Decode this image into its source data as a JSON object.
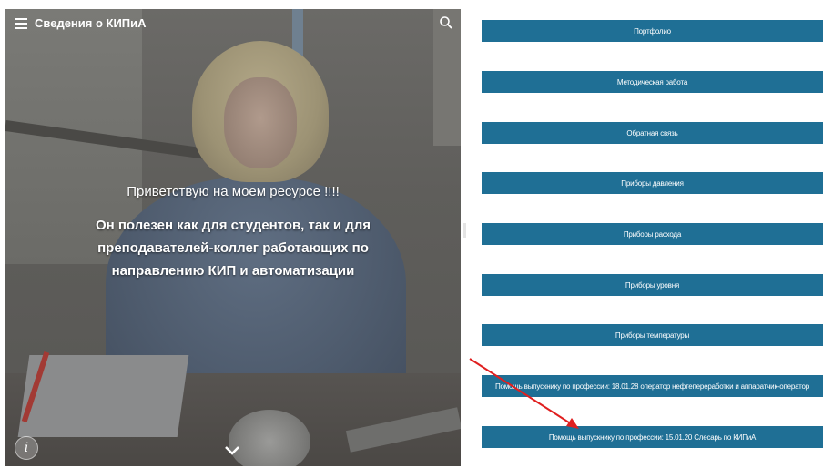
{
  "header": {
    "title": "Сведения о КИПиА"
  },
  "hero": {
    "greeting": "Приветствую на моем ресурсе !!!!",
    "description": "Он полезен как для студентов, так и для преподавателей-коллег работающих по направлению КИП и автоматизации"
  },
  "nav": {
    "buttons": [
      {
        "label": "Портфолио"
      },
      {
        "label": "Методическая работа"
      },
      {
        "label": "Обратная связь"
      },
      {
        "label": "Приборы давления"
      },
      {
        "label": "Приборы расхода"
      },
      {
        "label": "Приборы уровня"
      },
      {
        "label": "Приборы температуры"
      },
      {
        "label": "Помощь выпускнику по профессии: 18.01.28 оператор нефтепереработки и аппаратчик-оператор"
      },
      {
        "label": "Помощь выпускнику по профессии: 15.01.20 Слесарь по КИПиА"
      }
    ]
  },
  "colors": {
    "button_bg": "#1f6f95",
    "annotation_arrow": "#e02020"
  }
}
